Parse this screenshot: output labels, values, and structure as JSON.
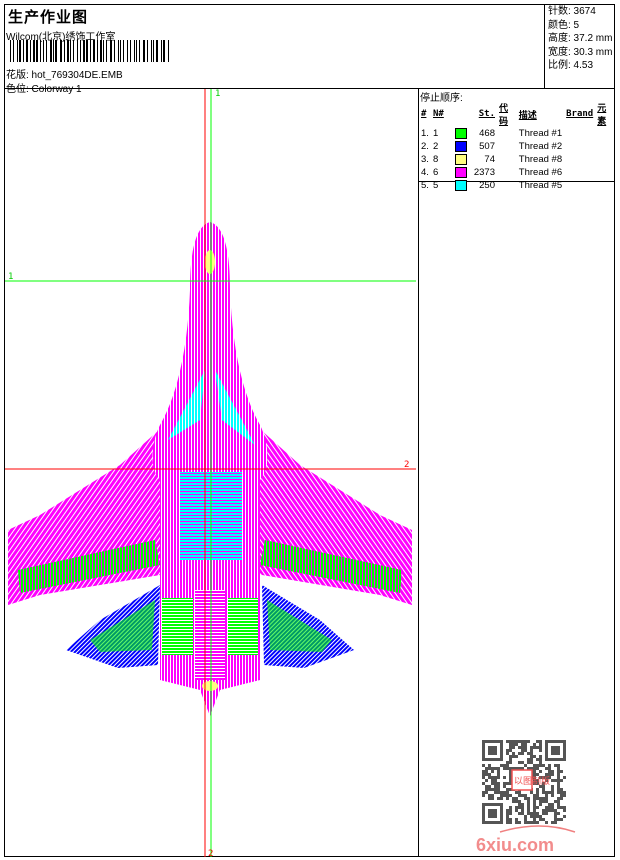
{
  "header": {
    "title": "生产作业图",
    "company": "Wilcom(北京)绣饰工作室",
    "design_label": "花版: hot_769304DE.EMB",
    "colorway_label": "色位:  Colorway 1"
  },
  "info": {
    "stitches": "针数: 3674",
    "colors": "颜色: 5",
    "height": "高度: 37.2 mm",
    "width": "宽度: 30.3 mm",
    "scale": "比例: 4.53"
  },
  "stop_sequence": {
    "title": "停止顺序:",
    "columns": [
      "#",
      "N#",
      "St.",
      "代码",
      "描述",
      "Brand",
      "元素"
    ],
    "rows": [
      {
        "seq": "1.",
        "n": "1",
        "color": "#00ff00",
        "stitches": "468",
        "desc": "Thread #1"
      },
      {
        "seq": "2.",
        "n": "2",
        "color": "#0000ff",
        "stitches": "507",
        "desc": "Thread #2"
      },
      {
        "seq": "3.",
        "n": "8",
        "color": "#ffff80",
        "stitches": "74",
        "desc": "Thread #8"
      },
      {
        "seq": "4.",
        "n": "6",
        "color": "#ff00ff",
        "stitches": "2373",
        "desc": "Thread #6"
      },
      {
        "seq": "5.",
        "n": "5",
        "color": "#00ffff",
        "stitches": "250",
        "desc": "Thread #5"
      }
    ]
  },
  "guides": {
    "v1": "1",
    "h1": "1",
    "h2": "2",
    "v2": "2"
  },
  "watermark": {
    "site": "6xiu.com",
    "seal": "以图制版"
  },
  "colors": {
    "guide_green": "#00ff00",
    "guide_red": "#ff0000"
  }
}
